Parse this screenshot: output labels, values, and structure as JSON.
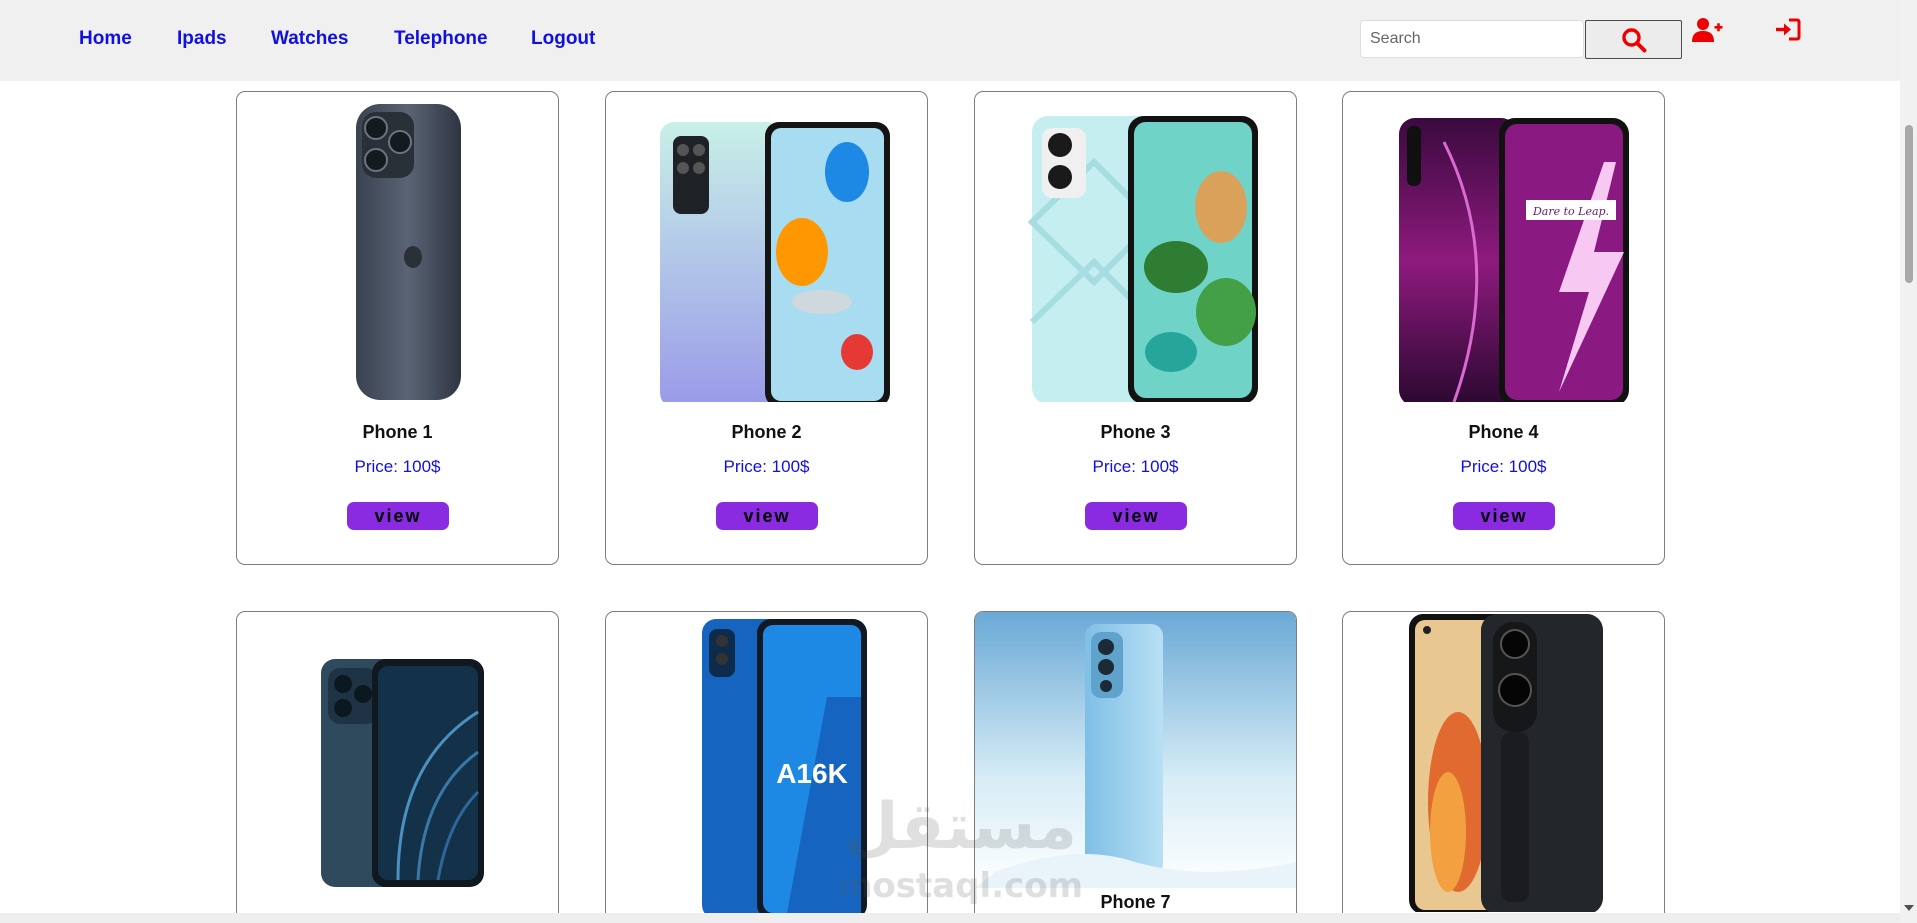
{
  "nav": {
    "links": [
      {
        "label": "Home"
      },
      {
        "label": "Ipads"
      },
      {
        "label": "Watches"
      },
      {
        "label": "Telephone"
      },
      {
        "label": "Logout"
      }
    ],
    "search_placeholder": "Search",
    "search_icon": "magnifier-icon",
    "register_icon": "user-plus-icon",
    "login_icon": "sign-in-icon",
    "accent_color": "#ff0000",
    "link_color": "#1010e0"
  },
  "products": [
    {
      "name": "Phone 1",
      "price": "Price: 100$",
      "button": "view"
    },
    {
      "name": "Phone 2",
      "price": "Price: 100$",
      "button": "view"
    },
    {
      "name": "Phone 3",
      "price": "Price: 100$",
      "button": "view"
    },
    {
      "name": "Phone 4",
      "price": "Price: 100$",
      "button": "view"
    }
  ],
  "products_row2": [
    {
      "name": ""
    },
    {
      "name": ""
    },
    {
      "name": "Phone 7"
    },
    {
      "name": ""
    }
  ],
  "phone_screen_labels": {
    "phone4_slogan": "Dare to Leap.",
    "phone6_model": "A16K"
  },
  "watermark": {
    "arabic": "مستقل",
    "latin": "mostaql.com"
  },
  "colors": {
    "button": "#8a2be2",
    "navbar_bg": "#f0f0f0",
    "card_border": "#7d7d7d"
  }
}
